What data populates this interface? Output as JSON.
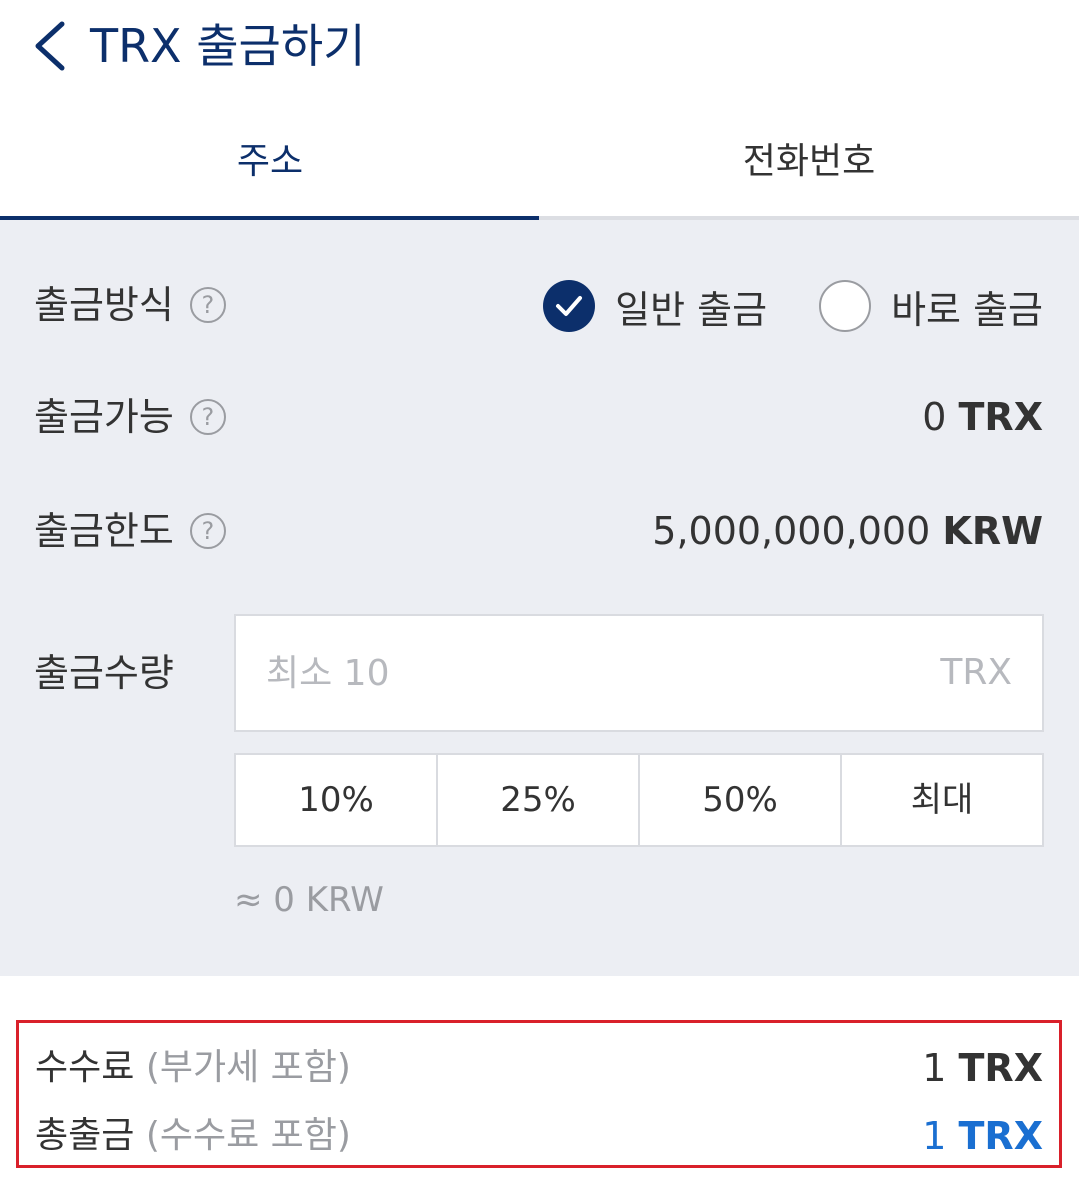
{
  "header": {
    "title": "TRX 출금하기"
  },
  "tabs": [
    {
      "label": "주소",
      "active": true
    },
    {
      "label": "전화번호",
      "active": false
    }
  ],
  "method": {
    "label": "출금방식",
    "options": [
      {
        "label": "일반 출금",
        "selected": true
      },
      {
        "label": "바로 출금",
        "selected": false
      }
    ]
  },
  "available": {
    "label": "출금가능",
    "amount": "0",
    "unit": "TRX"
  },
  "limit": {
    "label": "출금한도",
    "amount": "5,000,000,000",
    "unit": "KRW"
  },
  "quantity": {
    "label": "출금수량",
    "placeholder": "최소 10",
    "unit": "TRX",
    "presets": [
      "10%",
      "25%",
      "50%",
      "최대"
    ],
    "krw_estimate": "≈ 0 KRW"
  },
  "fee": {
    "label": "수수료",
    "label_sub": "(부가세 포함)",
    "amount": "1",
    "unit": "TRX"
  },
  "total": {
    "label": "총출금",
    "label_sub": "(수수료 포함)",
    "amount": "1",
    "unit": "TRX"
  },
  "colors": {
    "brand": "#0c2f6b",
    "highlight_border": "#d9202a",
    "total_value": "#1a6fd1"
  }
}
